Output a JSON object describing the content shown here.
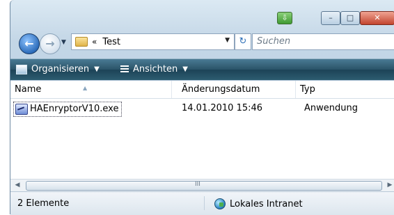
{
  "window": {
    "icons": {
      "app": "green-app-icon",
      "minimize": "minimize-icon",
      "maximize": "maximize-icon",
      "close": "close-icon"
    },
    "controls": {
      "minimize_glyph": "–",
      "maximize_glyph": "□",
      "close_glyph": "✕",
      "app_glyph": "⇩"
    }
  },
  "navigation": {
    "back_icon": "back-arrow-icon",
    "forward_icon": "forward-arrow-icon",
    "history_dropdown": "▼"
  },
  "address": {
    "chevron": "«",
    "path": "Test",
    "dropdown": "▼",
    "refresh_glyph": "↻"
  },
  "search": {
    "placeholder": "Suchen"
  },
  "toolbar": {
    "organize_label": "Organisieren",
    "views_label": "Ansichten",
    "arrow": "▼",
    "help_glyph": "?"
  },
  "table": {
    "columns": [
      "Name",
      "Änderungsdatum",
      "Typ"
    ],
    "rows": [
      {
        "name": "HAEnryptorV10.exe",
        "date": "14.01.2010 15:46",
        "type": "Anwendung"
      }
    ]
  },
  "scrollbar": {
    "left": "◀",
    "right": "▶",
    "grip": "III"
  },
  "status": {
    "count": "2 Elemente",
    "zone": "Lokales Intranet"
  },
  "colors": {
    "toolbar": "#2a5368",
    "frame": "#c3d6e6",
    "close_button": "#c2452e"
  }
}
